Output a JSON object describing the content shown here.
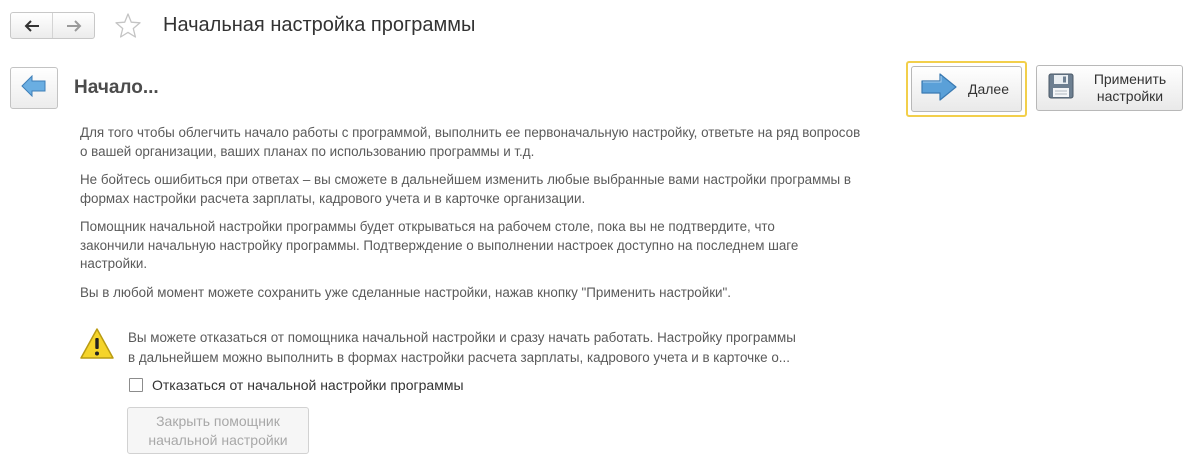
{
  "header": {
    "title": "Начальная настройка программы",
    "nav_back_icon": "arrow-left-icon",
    "nav_forward_icon": "arrow-right-icon",
    "favorite_icon": "star-icon"
  },
  "step": {
    "title": "Начало...",
    "back_icon": "blue-arrow-left-icon"
  },
  "actions": {
    "next": {
      "label": "Далее",
      "icon": "blue-arrow-right-icon"
    },
    "apply": {
      "label_line1": "Применить",
      "label_line2": "настройки",
      "icon": "floppy-disk-icon"
    }
  },
  "content": {
    "p1": "Для того чтобы облегчить начало работы с программой, выполнить ее первоначальную настройку, ответьте на ряд вопросов о вашей организации, ваших планах по использованию программы и т.д.",
    "p2_line1": "Не бойтесь ошибиться при ответах – вы сможете в дальнейшем изменить любые выбранные вами настройки программы в",
    "p2_line2": "формах настройки расчета зарплаты, кадрового учета и в карточке организации.",
    "p3_line1": "Помощник начальной настройки программы будет открываться на рабочем столе, пока вы не подтвердите, что",
    "p3_line2": "закончили начальную настройку программы. Подтверждение о выполнении настроек доступно на последнем шаге",
    "p3_line3": "настройки.",
    "p4": "Вы в любой момент можете сохранить уже сделанные настройки, нажав кнопку \"Применить настройки\"."
  },
  "warning": {
    "icon": "warning-icon",
    "line1": "Вы можете отказаться от помощника начальной настройки и сразу начать работать. Настройку программы",
    "line2": "в дальнейшем можно выполнить в формах настройки расчета зарплаты, кадрового учета и в карточке о..."
  },
  "decline": {
    "checked": false,
    "label": "Отказаться от начальной настройки программы"
  },
  "close_wizard": {
    "label_line1": "Закрыть помощник",
    "label_line2": "начальной настройки",
    "enabled": false
  },
  "colors": {
    "accent_yellow": "#f2cf4b",
    "arrow_blue": "#5aa0d8",
    "text": "#5a5a5a"
  }
}
